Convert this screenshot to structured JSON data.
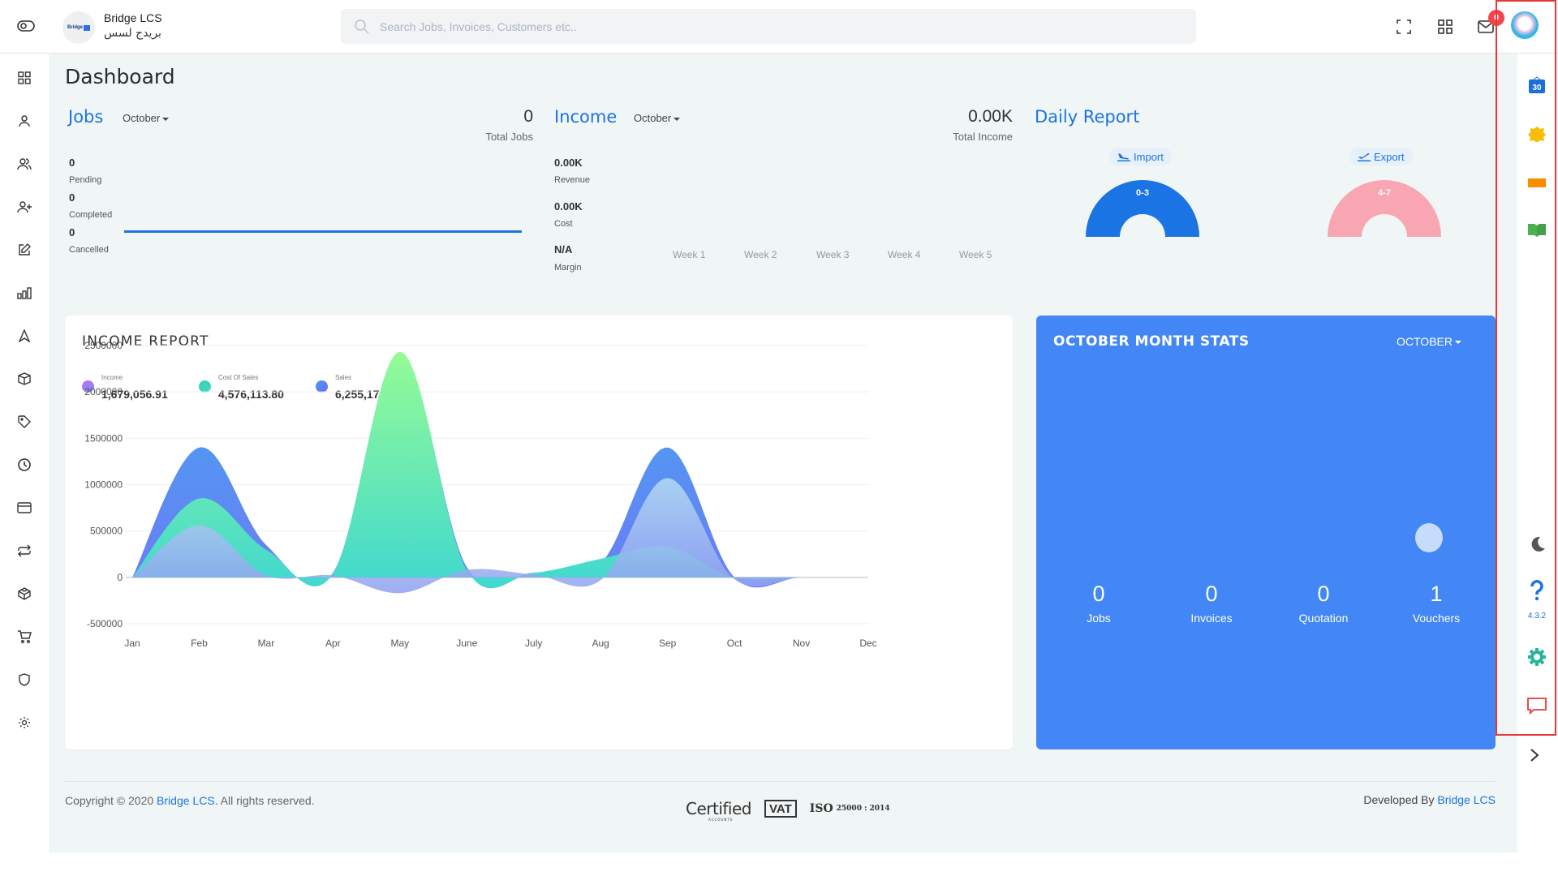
{
  "header": {
    "brand_name": "Bridge LCS",
    "brand_name_ar": "بريدج لسس",
    "logo_text": "Bridge",
    "search_placeholder": "Search Jobs, Invoices, Customers etc..",
    "notification_count": "0"
  },
  "left_sidebar": {
    "items": [
      {
        "icon": "dashboard-grid-icon"
      },
      {
        "icon": "user-icon"
      },
      {
        "icon": "users-icon"
      },
      {
        "icon": "user-add-icon"
      },
      {
        "icon": "edit-icon"
      },
      {
        "icon": "bar-chart-icon"
      },
      {
        "icon": "navigation-icon"
      },
      {
        "icon": "box-icon"
      },
      {
        "icon": "tag-icon"
      },
      {
        "icon": "clock-icon"
      },
      {
        "icon": "credit-card-icon"
      },
      {
        "icon": "repeat-icon"
      },
      {
        "icon": "codesandbox-icon"
      },
      {
        "icon": "cart-icon"
      },
      {
        "icon": "shield-icon"
      },
      {
        "icon": "settings-icon"
      }
    ]
  },
  "right_sidebar": {
    "items": [
      {
        "icon": "calendar-icon",
        "label": "30"
      },
      {
        "icon": "sticky-note-icon"
      },
      {
        "icon": "folder-icon"
      },
      {
        "icon": "book-icon"
      },
      {
        "icon": "dark-mode-moon-icon"
      },
      {
        "icon": "help-icon"
      },
      {
        "icon": "settings-gear-icon"
      },
      {
        "icon": "chat-icon"
      }
    ],
    "version": "4.3.2",
    "expand_icon": "chevron-right-icon"
  },
  "dashboard": {
    "title": "Dashboard",
    "jobs": {
      "title": "Jobs",
      "month": "October",
      "total": "0",
      "total_label": "Total Jobs",
      "stats": [
        {
          "value": "0",
          "label": "Pending"
        },
        {
          "value": "0",
          "label": "Completed"
        },
        {
          "value": "0",
          "label": "Cancelled"
        }
      ]
    },
    "income": {
      "title": "Income",
      "month": "October",
      "total": "0.00K",
      "total_label": "Total Income",
      "stats": [
        {
          "value": "0.00K",
          "label": "Revenue"
        },
        {
          "value": "0.00K",
          "label": "Cost"
        },
        {
          "value": "N/A",
          "label": "Margin"
        }
      ],
      "weeks": [
        "Week 1",
        "Week 2",
        "Week 3",
        "Week 4",
        "Week 5"
      ]
    },
    "daily_report": {
      "title": "Daily Report",
      "import": {
        "label": "Import",
        "range": "0-3",
        "color": "#1b74e4"
      },
      "export": {
        "label": "Export",
        "range": "4-7",
        "color": "#f8a5b0"
      }
    }
  },
  "income_report": {
    "title": "INCOME REPORT",
    "legend": [
      {
        "label": "Income",
        "value": "1,679,056.91"
      },
      {
        "label": "Cost Of Sales",
        "value": "4,576,113.80"
      },
      {
        "label": "Sales",
        "value": "6,255,170.71"
      }
    ]
  },
  "chart_data": {
    "type": "area",
    "title": "INCOME REPORT",
    "categories": [
      "Jan",
      "Feb",
      "Mar",
      "Apr",
      "May",
      "June",
      "July",
      "Aug",
      "Sep",
      "Oct",
      "Nov",
      "Dec"
    ],
    "yticks": [
      "2500000",
      "2000000",
      "1500000",
      "1000000",
      "500000",
      "0",
      "-500000"
    ],
    "ylim": [
      -500000,
      2500000
    ],
    "grid": true,
    "series": [
      {
        "name": "Sales",
        "color": "#4a90e8",
        "values": [
          0,
          1400000,
          350000,
          50000,
          2400000,
          110000,
          50000,
          150000,
          1400000,
          0,
          0,
          0
        ]
      },
      {
        "name": "Cost Of Sales",
        "color": "#3fd9b5",
        "values": [
          0,
          850000,
          300000,
          40000,
          2430000,
          80000,
          50000,
          200000,
          330000,
          0,
          0,
          0
        ]
      },
      {
        "name": "Income",
        "color": "#9aa8f0",
        "values": [
          0,
          560000,
          20000,
          20000,
          -170000,
          80000,
          30000,
          -30000,
          1070000,
          -20000,
          0,
          0
        ]
      }
    ]
  },
  "month_stats": {
    "title": "OCTOBER MONTH STATS",
    "month": "OCTOBER",
    "items": [
      {
        "value": "0",
        "label": "Jobs"
      },
      {
        "value": "0",
        "label": "Invoices"
      },
      {
        "value": "0",
        "label": "Quotation"
      },
      {
        "value": "1",
        "label": "Vouchers"
      }
    ]
  },
  "footer": {
    "copyright_prefix": "Copyright © 2020 ",
    "company": "Bridge LCS",
    "copyright_suffix": ". All rights reserved.",
    "developed_by": "Developed By ",
    "certs": {
      "certified": "Certified",
      "certified_sub": "ACCOUNTS",
      "vat": "VAT",
      "iso": "ISO",
      "iso_std": "25000 : 2014"
    }
  }
}
